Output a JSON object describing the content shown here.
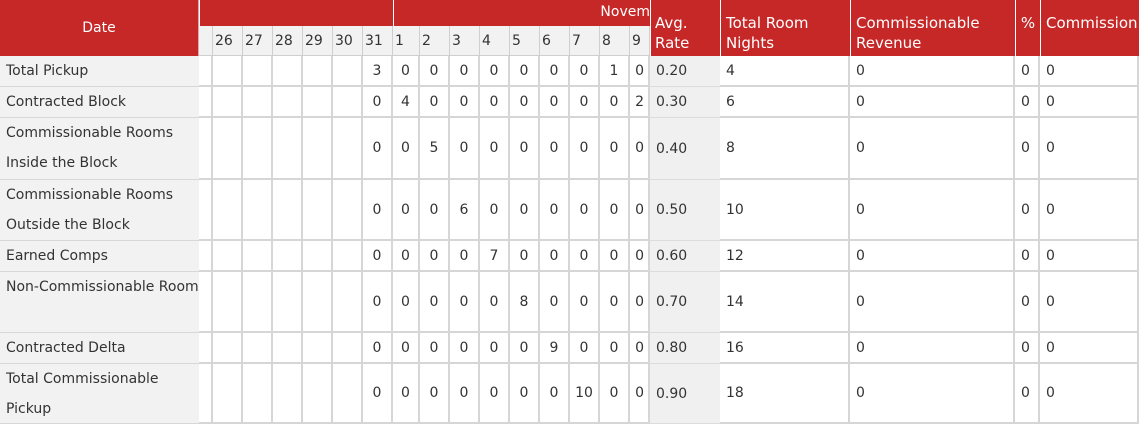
{
  "header": {
    "date_label": "Date",
    "month_label": "Novem",
    "days_prev": [
      "26",
      "27",
      "28",
      "29",
      "30",
      "31"
    ],
    "days_next": [
      "1",
      "2",
      "3",
      "4",
      "5",
      "6",
      "7",
      "8",
      "9"
    ],
    "avg_rate": "Avg. Rate",
    "total_room_nights": "Total Room Nights",
    "commissionable_revenue": "Commissionable Revenue",
    "percent": "%",
    "commission": "Commission"
  },
  "rows": [
    {
      "label": "Total Pickup",
      "values": [
        "3",
        "0",
        "0",
        "0",
        "0",
        "0",
        "0",
        "0",
        "1",
        "0"
      ],
      "avg_rate": "0.20",
      "total_room_nights": "4",
      "revenue": "0",
      "percent": "0",
      "commission": "0"
    },
    {
      "label": "Contracted Block",
      "values": [
        "0",
        "4",
        "0",
        "0",
        "0",
        "0",
        "0",
        "0",
        "0",
        "2"
      ],
      "avg_rate": "0.30",
      "total_room_nights": "6",
      "revenue": "0",
      "percent": "0",
      "commission": "0"
    },
    {
      "label": "Commissionable Rooms Inside the Block",
      "values": [
        "0",
        "0",
        "5",
        "0",
        "0",
        "0",
        "0",
        "0",
        "0",
        "0"
      ],
      "avg_rate": "0.40",
      "total_room_nights": "8",
      "revenue": "0",
      "percent": "0",
      "commission": "0"
    },
    {
      "label": "Commissionable Rooms Outside the Block",
      "values": [
        "0",
        "0",
        "0",
        "6",
        "0",
        "0",
        "0",
        "0",
        "0",
        "0"
      ],
      "avg_rate": "0.50",
      "total_room_nights": "10",
      "revenue": "0",
      "percent": "0",
      "commission": "0"
    },
    {
      "label": "Earned Comps",
      "values": [
        "0",
        "0",
        "0",
        "0",
        "7",
        "0",
        "0",
        "0",
        "0",
        "0"
      ],
      "avg_rate": "0.60",
      "total_room_nights": "12",
      "revenue": "0",
      "percent": "0",
      "commission": "0"
    },
    {
      "label": "Non-Commissionable Room",
      "values": [
        "0",
        "0",
        "0",
        "0",
        "0",
        "8",
        "0",
        "0",
        "0",
        "0"
      ],
      "avg_rate": "0.70",
      "total_room_nights": "14",
      "revenue": "0",
      "percent": "0",
      "commission": "0"
    },
    {
      "label": "Contracted Delta",
      "values": [
        "0",
        "0",
        "0",
        "0",
        "0",
        "0",
        "9",
        "0",
        "0",
        "0"
      ],
      "avg_rate": "0.80",
      "total_room_nights": "16",
      "revenue": "0",
      "percent": "0",
      "commission": "0"
    },
    {
      "label": "Total Commissionable Pickup",
      "values": [
        "0",
        "0",
        "0",
        "0",
        "0",
        "0",
        "0",
        "10",
        "0",
        "0"
      ],
      "avg_rate": "0.90",
      "total_room_nights": "18",
      "revenue": "0",
      "percent": "0",
      "commission": "0"
    }
  ]
}
